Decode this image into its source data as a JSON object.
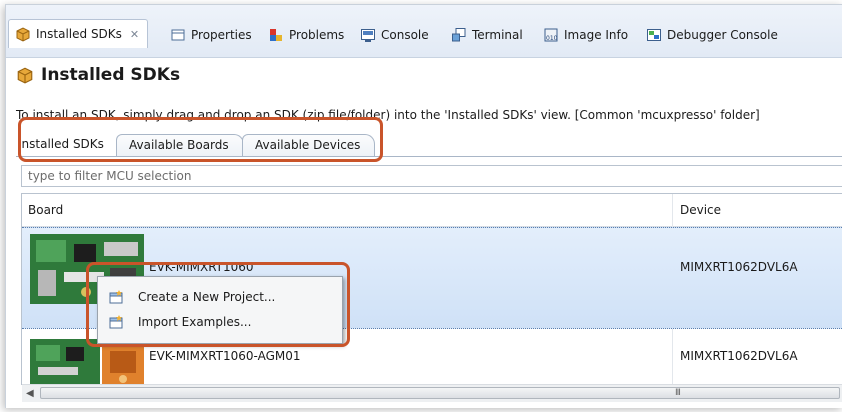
{
  "tabs": [
    {
      "label": "Installed SDKs",
      "icon": "sdk-icon"
    },
    {
      "label": "Properties",
      "icon": "properties-icon"
    },
    {
      "label": "Problems",
      "icon": "problems-icon"
    },
    {
      "label": "Console",
      "icon": "console-icon"
    },
    {
      "label": "Terminal",
      "icon": "terminal-icon"
    },
    {
      "label": "Image Info",
      "icon": "image-info-icon"
    },
    {
      "label": "Debugger Console",
      "icon": "debugger-icon"
    }
  ],
  "view": {
    "title": "Installed SDKs",
    "instruction": "To install an SDK, simply drag and drop an SDK (zip file/folder) into the 'Installed SDKs' view. [Common 'mcuxpresso' folder]"
  },
  "inner_tabs": [
    "Installed SDKs",
    "Available Boards",
    "Available Devices"
  ],
  "filter": {
    "placeholder": "type to filter MCU selection"
  },
  "table": {
    "columns": [
      "Board",
      "Device"
    ],
    "rows": [
      {
        "board": "EVK-MIMXRT1060",
        "device": "MIMXRT1062DVL6A"
      },
      {
        "board": "EVK-MIMXRT1060-AGM01",
        "device": "MIMXRT1062DVL6A"
      }
    ]
  },
  "context_menu": {
    "items": [
      "Create a New Project...",
      "Import Examples..."
    ]
  },
  "scrollbar": {
    "grip": "III"
  },
  "colors": {
    "accent": "#c9542a",
    "selection": "#cfe1f7",
    "tab_bg": "#e2eaf5"
  }
}
